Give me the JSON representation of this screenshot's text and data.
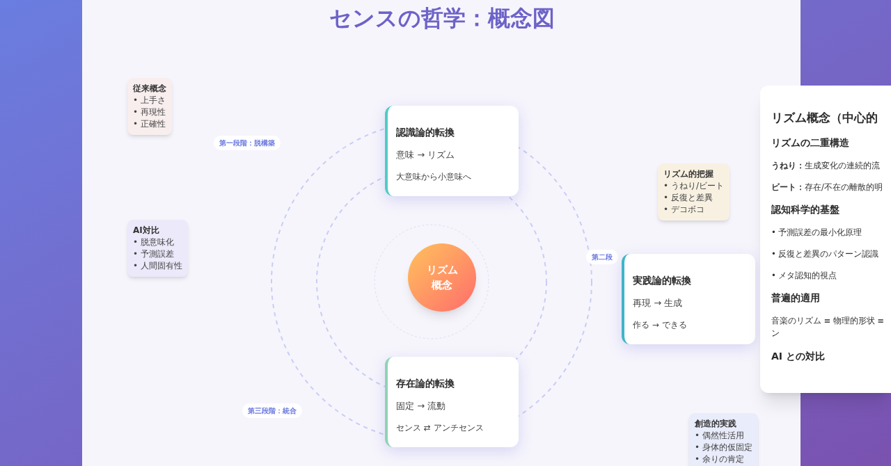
{
  "title": "センスの哲学：概念図",
  "center": {
    "lines": [
      "リズム",
      "概念"
    ]
  },
  "stages": [
    {
      "label": "第一段階：脱構築"
    },
    {
      "label": "第二段"
    },
    {
      "label": "第三段階：統合"
    }
  ],
  "transforms": [
    {
      "title": "認識論的転換",
      "shift": "意味 → リズム",
      "note": "大意味から小意味へ",
      "color": "#4ecdc4"
    },
    {
      "title": "実践論的転換",
      "shift": "再現 → 生成",
      "note": "作る → できる",
      "color": "#3fb5c9"
    },
    {
      "title": "存在論的転換",
      "shift": "固定 → 流動",
      "note": "センス ⇄ アンチセンス",
      "color": "#8fd3b4"
    }
  ],
  "notes": [
    {
      "title": "従来概念",
      "items": [
        "• 上手さ",
        "• 再現性",
        "• 正確性"
      ],
      "color": "#f8eeee"
    },
    {
      "title": "AI対比",
      "items": [
        "• 脱意味化",
        "• 予測誤差",
        "• 人間固有性"
      ],
      "color": "#ece9fa"
    },
    {
      "title": "リズム的把握",
      "items": [
        "• うねり/ビート",
        "• 反復と差異",
        "• デコボコ"
      ],
      "color": "#f8f1e2"
    },
    {
      "title": "創造的実践",
      "items": [
        "• 偶然性活用",
        "• 身体的仮固定",
        "• 余りの肯定"
      ],
      "color": "#e9ecfa"
    }
  ],
  "detail_panel": {
    "title": "リズム概念（中心的",
    "sections": [
      {
        "heading": "リズムの二重構造",
        "kind": "lines",
        "items": [
          "**うねり：**生成変化の連続的流",
          "**ビート：**存在/不在の離散的明"
        ]
      },
      {
        "heading": "認知科学的基盤",
        "kind": "lines",
        "items": [
          "• 予測誤差の最小化原理",
          "• 反復と差異のパターン認識",
          "• メタ認知的視点"
        ]
      },
      {
        "heading": "普遍的適用",
        "kind": "para",
        "items": [
          "音楽のリズム ≡ 物理的形状 ≡",
          "ン"
        ]
      },
      {
        "heading": "AI との対比",
        "kind": "lines"
      }
    ]
  }
}
